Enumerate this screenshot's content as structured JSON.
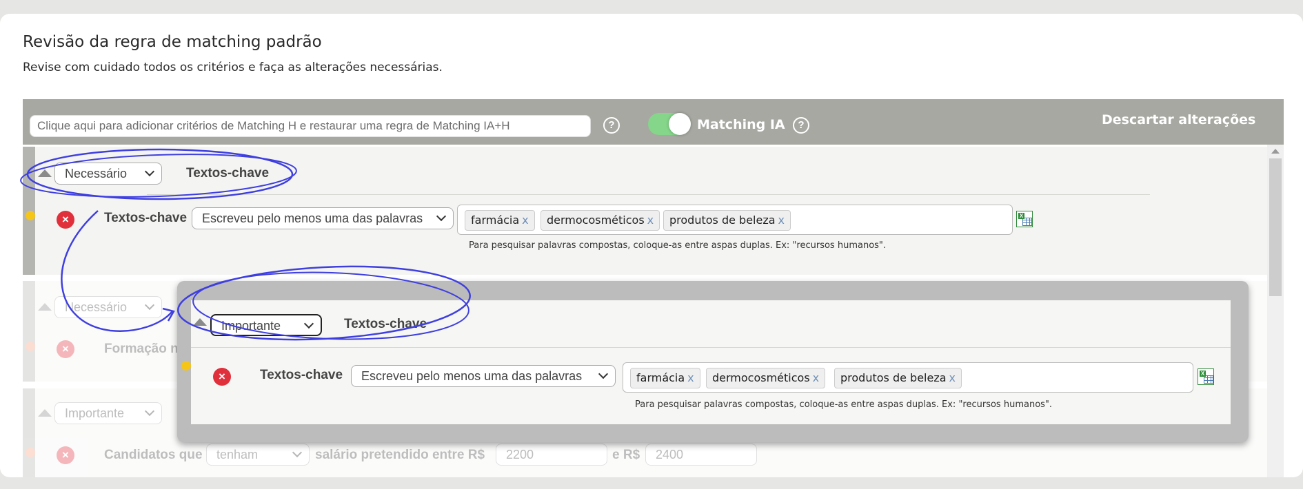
{
  "page": {
    "title": "Revisão da regra de matching padrão",
    "subtitle": "Revise com cuidado todos os critérios e faça as alterações necessárias."
  },
  "toolbar": {
    "search_placeholder": "Clique aqui para adicionar critérios de Matching H e restaurar uma regra de Matching IA+H",
    "help_glyph": "?",
    "toggle_label": "Matching IA",
    "toggle_on": true,
    "discard_label": "Descartar alterações"
  },
  "sections": [
    {
      "priority": "Necessário",
      "header": "Textos-chave",
      "criterion_label": "Textos-chave",
      "condition": "Escreveu pelo menos uma das palavras",
      "tags": [
        "farmácia",
        "dermocosméticos",
        "produtos de beleza"
      ],
      "hint": "Para pesquisar palavras compostas, coloque-as entre aspas duplas. Ex: \"recursos humanos\"."
    },
    {
      "priority": "Necessário",
      "criterion_label": "Formação n"
    },
    {
      "priority": "Importante",
      "criterion_label": "Candidatos que",
      "condition": "tenham",
      "middle_text": "salário pretendido entre R$",
      "min_value": "2200",
      "joiner": "e R$",
      "max_value": "2400"
    }
  ],
  "popup": {
    "priority": "Importante",
    "header": "Textos-chave",
    "criterion_label": "Textos-chave",
    "condition": "Escreveu pelo menos uma das palavras",
    "tags": [
      "farmácia",
      "dermocosméticos",
      "produtos de beleza"
    ],
    "hint": "Para pesquisar palavras compostas, coloque-as entre aspas duplas. Ex: \"recursos humanos\"."
  },
  "glyphs": {
    "remove": "×",
    "tag_remove": "x",
    "excel": "X"
  },
  "colors": {
    "toolbar": "#a8a8a2",
    "toggle": "#85d68a",
    "remove": "#e0303c",
    "annotation": "#3f3fe0",
    "dot": "#f5c518"
  },
  "icons": [
    "help-icon",
    "excel-icon",
    "remove-icon",
    "collapse-icon",
    "chevron-down-icon"
  ]
}
